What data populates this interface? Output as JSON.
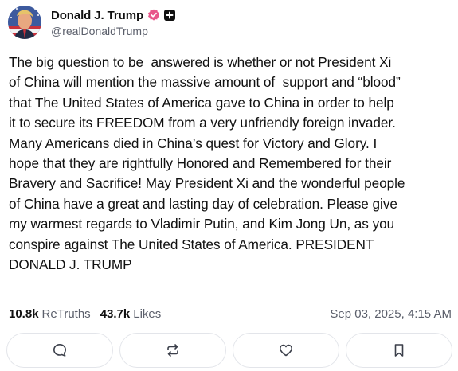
{
  "post": {
    "author": {
      "display_name": "Donald J. Trump",
      "handle": "@realDonaldTrump",
      "verified_icon": "verified-badge-icon",
      "plus_icon": "plus-badge-icon"
    },
    "text": "The big question to be  answered is whether or not President Xi\nof China will mention the massive amount of  support and “blood”\nthat The United States of America gave to China in order to help\nit to secure its FREEDOM from a very unfriendly foreign invader.\nMany Americans died in China’s quest for Victory and Glory. I\nhope that they are rightfully Honored and Remembered for their\nBravery and Sacrifice! May President Xi and the wonderful people\nof China have a great and lasting day of celebration. Please give\nmy warmest regards to Vladimir Putin, and Kim Jong Un, as you\nconspire against The United States of America. PRESIDENT\nDONALD J. TRUMP",
    "stats": {
      "retruths_count": "10.8k",
      "retruths_label": "ReTruths",
      "likes_count": "43.7k",
      "likes_label": "Likes"
    },
    "timestamp": "Sep 03, 2025, 4:15 AM"
  },
  "actions": [
    {
      "name": "reply",
      "icon": "comment-icon"
    },
    {
      "name": "retruth",
      "icon": "retruth-icon"
    },
    {
      "name": "like",
      "icon": "heart-icon"
    },
    {
      "name": "bookmark",
      "icon": "bookmark-icon"
    }
  ],
  "colors": {
    "verified": "#E8568A",
    "text": "#111111",
    "muted": "#5B5F6B",
    "border": "#E3E5EA"
  }
}
